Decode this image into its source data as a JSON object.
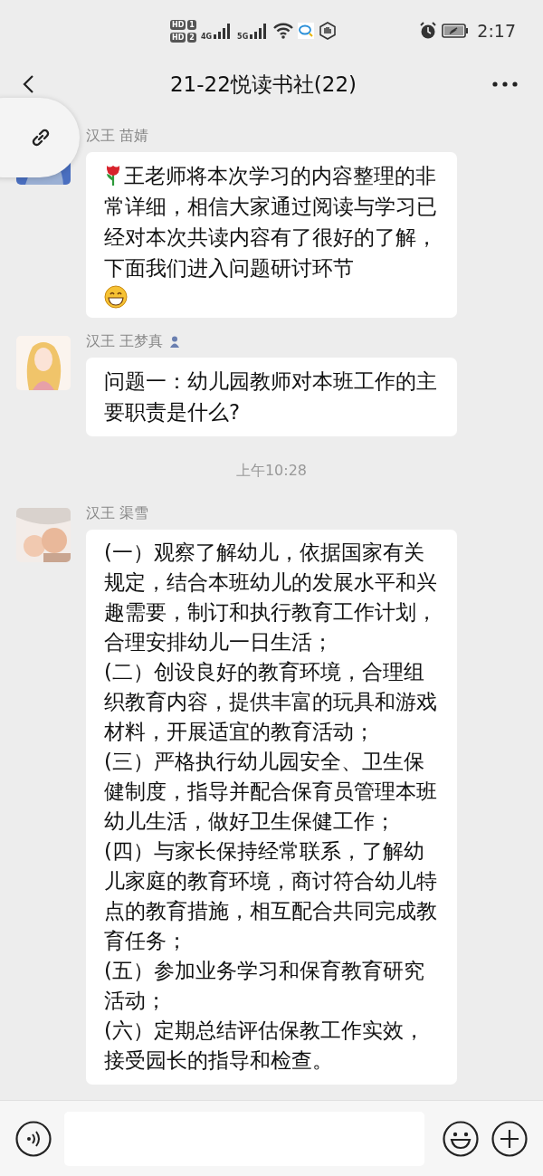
{
  "status_bar": {
    "hd_badges": [
      {
        "label": "HD",
        "slot": "1"
      },
      {
        "label": "HD",
        "slot": "2"
      }
    ],
    "networks": [
      "4G",
      "5G"
    ],
    "time": "2:17"
  },
  "header": {
    "title": "21-22悦读书社(22)"
  },
  "messages": [
    {
      "kind": "message",
      "sender": "汉王 苗婧",
      "badge": false,
      "emoji_before": true,
      "emoji_after": true,
      "paragraphs": [
        "王老师将本次学习的内容整理的非常详细，相信大家通过阅读与学习已经对本次共读内容有了很好的了解，下面我们进入问题研讨环节"
      ]
    },
    {
      "kind": "message",
      "sender": "汉王 王梦真",
      "badge": true,
      "emoji_before": false,
      "emoji_after": false,
      "paragraphs": [
        "问题一：幼儿园教师对本班工作的主要职责是什么?"
      ]
    },
    {
      "kind": "time",
      "text": "上午10:28"
    },
    {
      "kind": "message",
      "sender": "汉王 渠雪",
      "badge": false,
      "emoji_before": false,
      "emoji_after": false,
      "paragraphs": [
        "(一）观察了解幼儿，依据国家有关规定，结合本班幼儿的发展水平和兴趣需要，制订和执行教育工作计划，合理安排幼儿一日生活；",
        "(二）创设良好的教育环境，合理组织教育内容，提供丰富的玩具和游戏材料，开展适宜的教育活动；",
        "(三）严格执行幼儿园安全、卫生保健制度，指导并配合保育员管理本班幼儿生活，做好卫生保健工作；",
        "(四）与家长保持经常联系，了解幼儿家庭的教育环境，商讨符合幼儿特点的教育措施，相互配合共同完成教育任务；",
        "(五）参加业务学习和保育教育研究活动；",
        "(六）定期总结评估保教工作实效，接受园长的指导和检查。"
      ]
    }
  ]
}
